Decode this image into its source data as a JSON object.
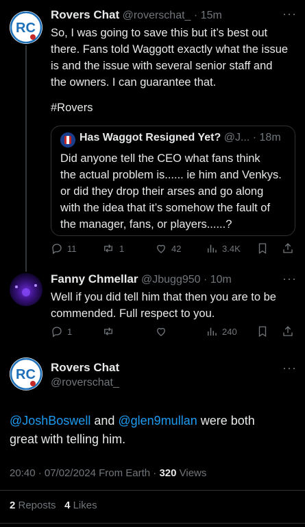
{
  "tweet1": {
    "name": "Rovers Chat",
    "handle": "@roverschat_",
    "time": "· 15m",
    "more": "···",
    "text_lines": [
      "So, I was going to save this but it’s best out",
      "there. Fans told Waggott exactly what the issue",
      "is and the issue with several senior staff and",
      "the owners. I can guarantee that."
    ],
    "hashtag": "#Rovers",
    "quote": {
      "name": "Has Waggot Resigned Yet?",
      "handle": "@J...",
      "time": "· 18m",
      "text_lines": [
        "Did anyone tell the CEO what fans think",
        "the actual problem is...... ie him and Venkys.",
        "or did they drop their arses and go along",
        "with the idea that it’s somehow the fault of",
        "the manager, fans, or players......?"
      ]
    },
    "actions": {
      "replies": "11",
      "reposts": "1",
      "likes": "42",
      "views": "3.4K"
    }
  },
  "tweet2": {
    "name": "Fanny Chmellar",
    "handle": "@Jbugg950",
    "time": "· 10m",
    "more": "···",
    "text_lines": [
      "Well if you did tell him that then you are to be",
      "commended. Full respect to you."
    ],
    "actions": {
      "replies": "1",
      "views": "240"
    }
  },
  "main_tweet": {
    "name": "Rovers Chat",
    "handle": "@roverschat_",
    "more": "···",
    "mention1": "@JoshBoswell",
    "and_text": " and ",
    "mention2": "@glen9mullan",
    "rest_line1": " were both",
    "line2": "great with telling him.",
    "meta_time": "20:40 · 07/02/2024 From Earth · ",
    "views_count": "320",
    "views_label": " Views",
    "reposts_count": "2",
    "reposts_label": " Reposts",
    "likes_count": "4",
    "likes_label": " Likes"
  },
  "icons": {
    "reply": "reply-icon",
    "repost": "repost-icon",
    "like": "heart-icon",
    "views": "views-icon",
    "bookmark": "bookmark-icon",
    "share": "share-icon"
  },
  "colors": {
    "background": "#000000",
    "text": "#e7e9ea",
    "muted": "#71767b",
    "link": "#1d9bf0",
    "border": "#2f3336"
  }
}
